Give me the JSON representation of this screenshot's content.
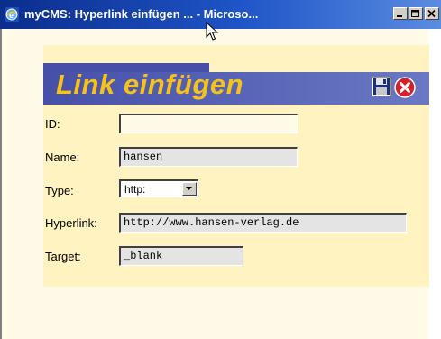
{
  "window": {
    "title": "myCMS: Hyperlink einfügen ... - Microso..."
  },
  "dialog": {
    "heading": "Link einfügen",
    "fields": {
      "id": {
        "label": "ID:",
        "value": ""
      },
      "name": {
        "label": "Name:",
        "value": "hansen"
      },
      "type": {
        "label": "Type:",
        "value": "http:"
      },
      "hyperlink": {
        "label": "Hyperlink:",
        "value": "http://www.hansen-verlag.de"
      },
      "target": {
        "label": "Target:",
        "value": "_blank"
      }
    }
  },
  "colors": {
    "title_bar": "#1f55c8",
    "heading_bar": "#4650a8",
    "heading_text": "#f6c21a",
    "panel": "#fff3c2"
  },
  "icons": [
    "ie-icon",
    "minimize-icon",
    "maximize-icon",
    "close-icon",
    "save-icon",
    "cancel-icon",
    "dropdown-arrow-icon",
    "cursor-icon"
  ]
}
